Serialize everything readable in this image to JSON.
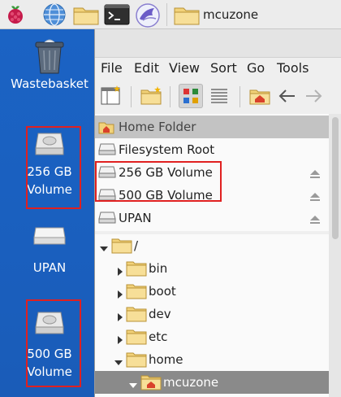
{
  "taskbar": {
    "icons": [
      "raspberry-menu-icon",
      "web-browser-icon",
      "file-manager-icon",
      "terminal-icon",
      "bird-app-icon"
    ],
    "task_title": "mcuzone"
  },
  "desktop": {
    "items": [
      {
        "label": "Wastebasket",
        "icon": "wastebasket-icon"
      },
      {
        "label_line1": "256 GB",
        "label_line2": "Volume",
        "icon": "drive-icon"
      },
      {
        "label": "UPAN",
        "icon": "drive-icon"
      },
      {
        "label_line1": "500 GB",
        "label_line2": "Volume",
        "icon": "drive-icon"
      }
    ]
  },
  "file_manager": {
    "menu": [
      "File",
      "Edit",
      "View",
      "Sort",
      "Go",
      "Tools"
    ],
    "places": [
      {
        "label": "Home Folder",
        "icon": "home-icon",
        "selected": true
      },
      {
        "label": "Filesystem Root",
        "icon": "drive-icon"
      },
      {
        "label": "256 GB Volume",
        "icon": "drive-icon",
        "eject": true
      },
      {
        "label": "500 GB Volume",
        "icon": "drive-icon",
        "eject": true
      },
      {
        "label": "UPAN",
        "icon": "drive-icon",
        "eject": true
      }
    ],
    "tree": [
      {
        "label": "/",
        "expanded": true
      },
      {
        "label": "bin"
      },
      {
        "label": "boot"
      },
      {
        "label": "dev"
      },
      {
        "label": "etc"
      },
      {
        "label": "home",
        "expanded": true
      },
      {
        "label": "mcuzone",
        "selected": true,
        "expanded": true
      }
    ]
  },
  "colors": {
    "desktop_bg": "#1b63c4",
    "highlight_box": "#e02020",
    "selection": "#8a8a8a",
    "folder": "#f5d98a"
  }
}
